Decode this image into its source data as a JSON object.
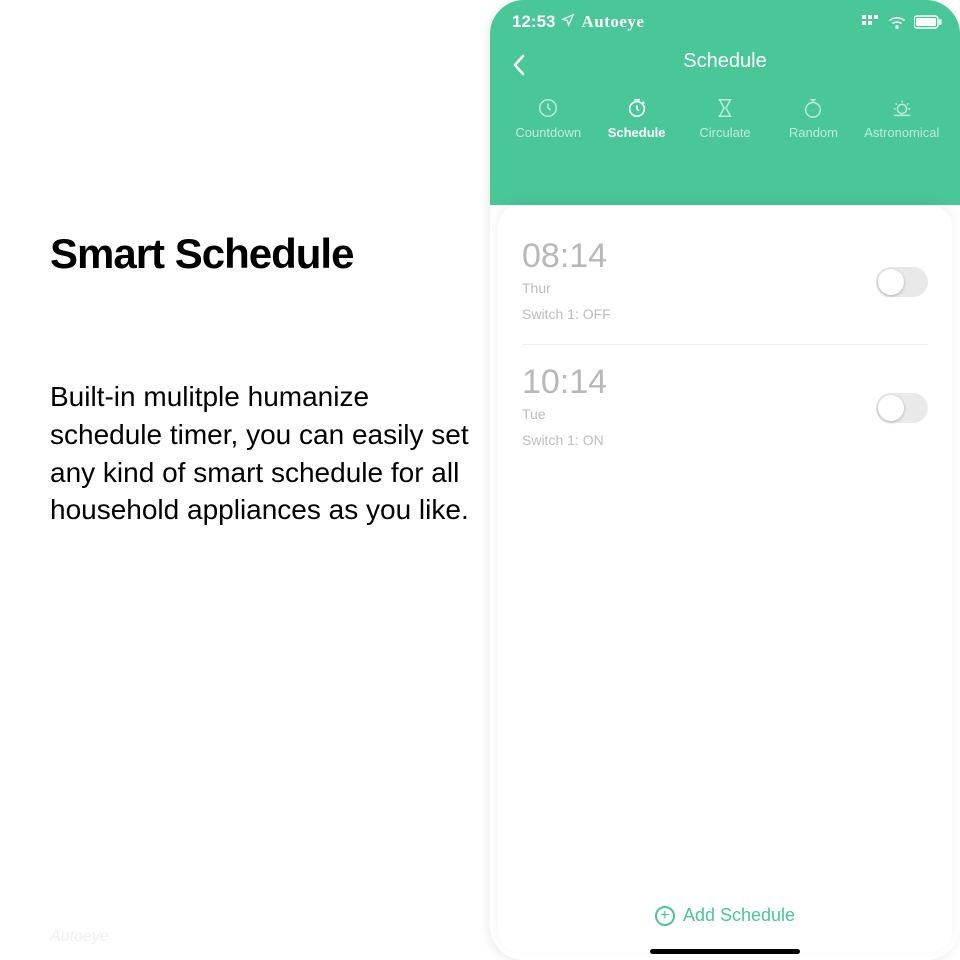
{
  "marketing": {
    "title": "Smart Schedule",
    "body": "Built-in mulitple humanize schedule timer, you can easily set any kind of smart schedule for all household appliances as you like."
  },
  "status": {
    "time": "12:53",
    "brand": "Autoeye"
  },
  "header": {
    "title": "Schedule"
  },
  "tabs": [
    {
      "label": "Countdown"
    },
    {
      "label": "Schedule"
    },
    {
      "label": "Circulate"
    },
    {
      "label": "Random"
    },
    {
      "label": "Astronomical"
    }
  ],
  "schedules": [
    {
      "time": "08:14",
      "day": "Thur",
      "state": "Switch 1: OFF"
    },
    {
      "time": "10:14",
      "day": "Tue",
      "state": "Switch 1: ON"
    }
  ],
  "footer": {
    "add_label": "Add Schedule"
  },
  "watermark": "Autoeye"
}
